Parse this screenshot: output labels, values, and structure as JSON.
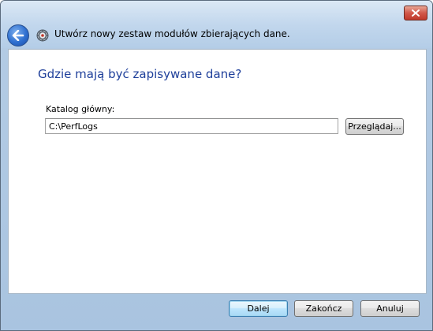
{
  "window": {
    "title": "Utwórz nowy zestaw modułów zbierających dane.",
    "icons": {
      "back": "back-arrow-icon",
      "app": "data-collector-gear-icon",
      "close": "close-icon"
    }
  },
  "page": {
    "heading": "Gdzie mają być zapisywane dane?"
  },
  "form": {
    "root_dir_label": "Katalog główny:",
    "root_dir_value": "C:\\PerfLogs",
    "browse_label": "Przeglądaj..."
  },
  "footer": {
    "next_label": "Dalej",
    "finish_label": "Zakończ",
    "cancel_label": "Anuluj"
  },
  "colors": {
    "heading": "#1e3f9a",
    "frame": "#b4cde7",
    "default_button_border": "#3c7fb1"
  }
}
